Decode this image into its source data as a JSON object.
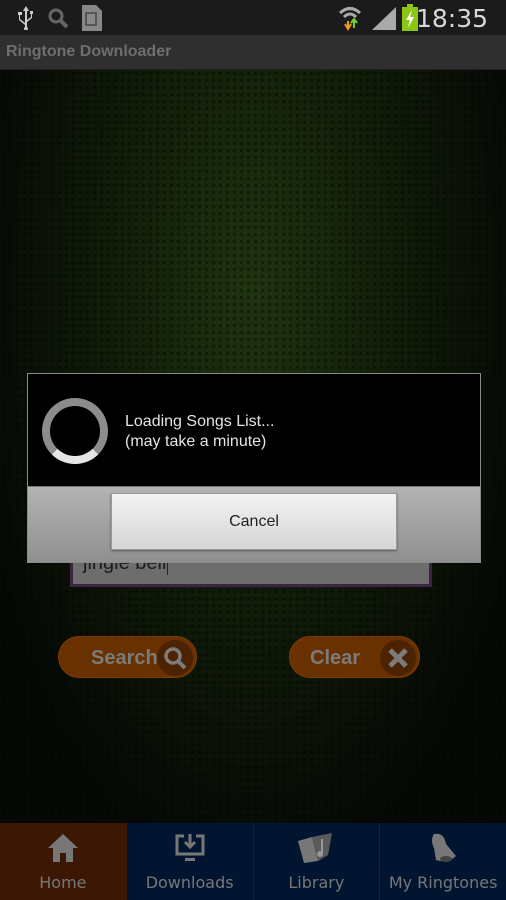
{
  "status_bar": {
    "time": "18:35",
    "icons": [
      "usb-icon",
      "search-icon",
      "sim-card-icon",
      "wifi-icon",
      "signal-icon",
      "battery-charging-icon"
    ]
  },
  "action_bar": {
    "title": "Ringtone Downloader"
  },
  "search": {
    "value": "jingle bell"
  },
  "buttons": {
    "search": "Search",
    "clear": "Clear"
  },
  "dialog": {
    "line1": "Loading Songs List...",
    "line2": "(may take a minute)",
    "cancel": "Cancel"
  },
  "nav": {
    "items": [
      {
        "label": "Home",
        "icon": "home-icon",
        "active": true
      },
      {
        "label": "Downloads",
        "icon": "download-icon"
      },
      {
        "label": "Library",
        "icon": "music-folder-icon"
      },
      {
        "label": "My Ringtones",
        "icon": "bell-icon"
      }
    ]
  }
}
